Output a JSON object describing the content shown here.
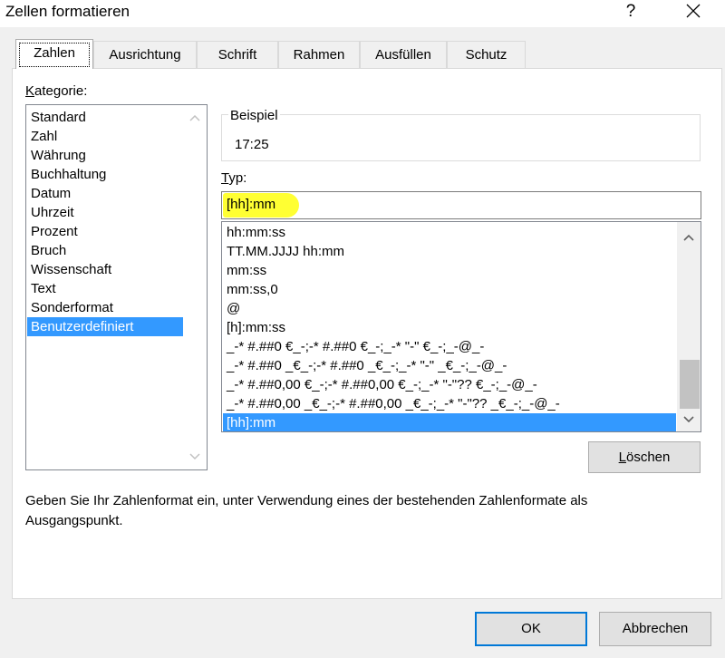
{
  "dialog": {
    "title": "Zellen formatieren",
    "help_glyph": "?"
  },
  "tabs": [
    {
      "label": "Zahlen",
      "active": true
    },
    {
      "label": "Ausrichtung",
      "active": false
    },
    {
      "label": "Schrift",
      "active": false
    },
    {
      "label": "Rahmen",
      "active": false
    },
    {
      "label": "Ausfüllen",
      "active": false
    },
    {
      "label": "Schutz",
      "active": false
    }
  ],
  "kategorie": {
    "label_underlined": "K",
    "label_rest": "ategorie:",
    "items": [
      "Standard",
      "Zahl",
      "Währung",
      "Buchhaltung",
      "Datum",
      "Uhrzeit",
      "Prozent",
      "Bruch",
      "Wissenschaft",
      "Text",
      "Sonderformat",
      "Benutzerdefiniert"
    ],
    "selected": "Benutzerdefiniert"
  },
  "beispiel": {
    "title": "Beispiel",
    "value": "17:25"
  },
  "typ": {
    "label_underlined": "T",
    "label_rest": "yp:",
    "value": "[hh]:mm",
    "highlight_color": "#ffff33"
  },
  "formats": {
    "items": [
      "hh:mm:ss",
      "TT.MM.JJJJ hh:mm",
      "mm:ss",
      "mm:ss,0",
      "@",
      "[h]:mm:ss",
      "_-* #.##0 €_-;-* #.##0 €_-;_-* \"-\" €_-;_-@_-",
      "_-* #.##0 _€_-;-* #.##0 _€_-;_-* \"-\" _€_-;_-@_-",
      "_-* #.##0,00 €_-;-* #.##0,00 €_-;_-* \"-\"?? €_-;_-@_-",
      "_-* #.##0,00 _€_-;-* #.##0,00 _€_-;_-* \"-\"?? _€_-;_-@_-",
      "[hh]:mm"
    ],
    "selected": "[hh]:mm"
  },
  "buttons": {
    "delete_underlined": "L",
    "delete_rest": "öschen",
    "ok": "OK",
    "cancel": "Abbrechen"
  },
  "hint": "Geben Sie Ihr Zahlenformat ein, unter Verwendung eines der bestehenden Zahlenformate als Ausgangspunkt.",
  "colors": {
    "selection": "#3399ff",
    "accent_border": "#0078d7"
  }
}
